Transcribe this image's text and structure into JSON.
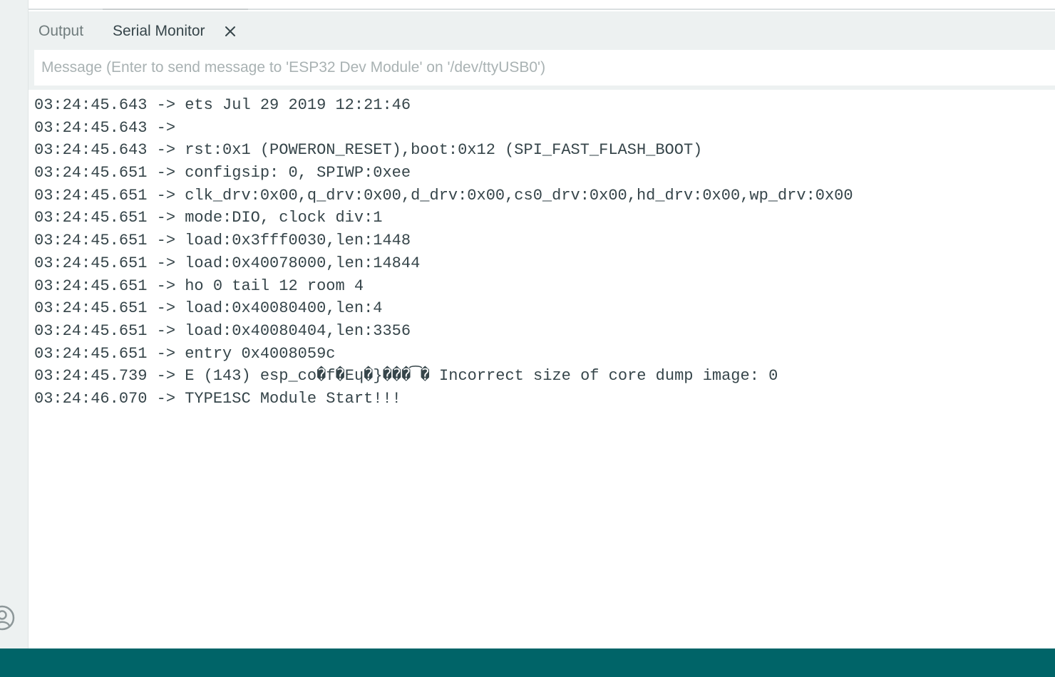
{
  "tabs": {
    "output_label": "Output",
    "serial_monitor_label": "Serial Monitor",
    "close_icon": "close-icon"
  },
  "message_input": {
    "placeholder": "Message (Enter to send message to 'ESP32 Dev Module' on '/dev/ttyUSB0')",
    "value": ""
  },
  "serial_log": [
    "03:24:45.643 -> ets Jul 29 2019 12:21:46",
    "03:24:45.643 -> ",
    "03:24:45.643 -> rst:0x1 (POWERON_RESET),boot:0x12 (SPI_FAST_FLASH_BOOT)",
    "03:24:45.651 -> configsip: 0, SPIWP:0xee",
    "03:24:45.651 -> clk_drv:0x00,q_drv:0x00,d_drv:0x00,cs0_drv:0x00,hd_drv:0x00,wp_drv:0x00",
    "03:24:45.651 -> mode:DIO, clock div:1",
    "03:24:45.651 -> load:0x3fff0030,len:1448",
    "03:24:45.651 -> load:0x40078000,len:14844",
    "03:24:45.651 -> ho 0 tail 12 room 4",
    "03:24:45.651 -> load:0x40080400,len:4",
    "03:24:45.651 -> load:0x40080404,len:3356",
    "03:24:45.651 -> entry 0x4008059c",
    "03:24:45.739 -> E (143) esp_co�f�Eɥ�}���͡� Incorrect size of core dump image: 0",
    "03:24:46.070 -> TYPE1SC Module Start!!!"
  ],
  "colors": {
    "status_bar": "#006468",
    "panel_background": "#edf1f1",
    "text": "#36454a",
    "placeholder": "#a9b2b3"
  },
  "icons": {
    "account": "account-icon"
  }
}
